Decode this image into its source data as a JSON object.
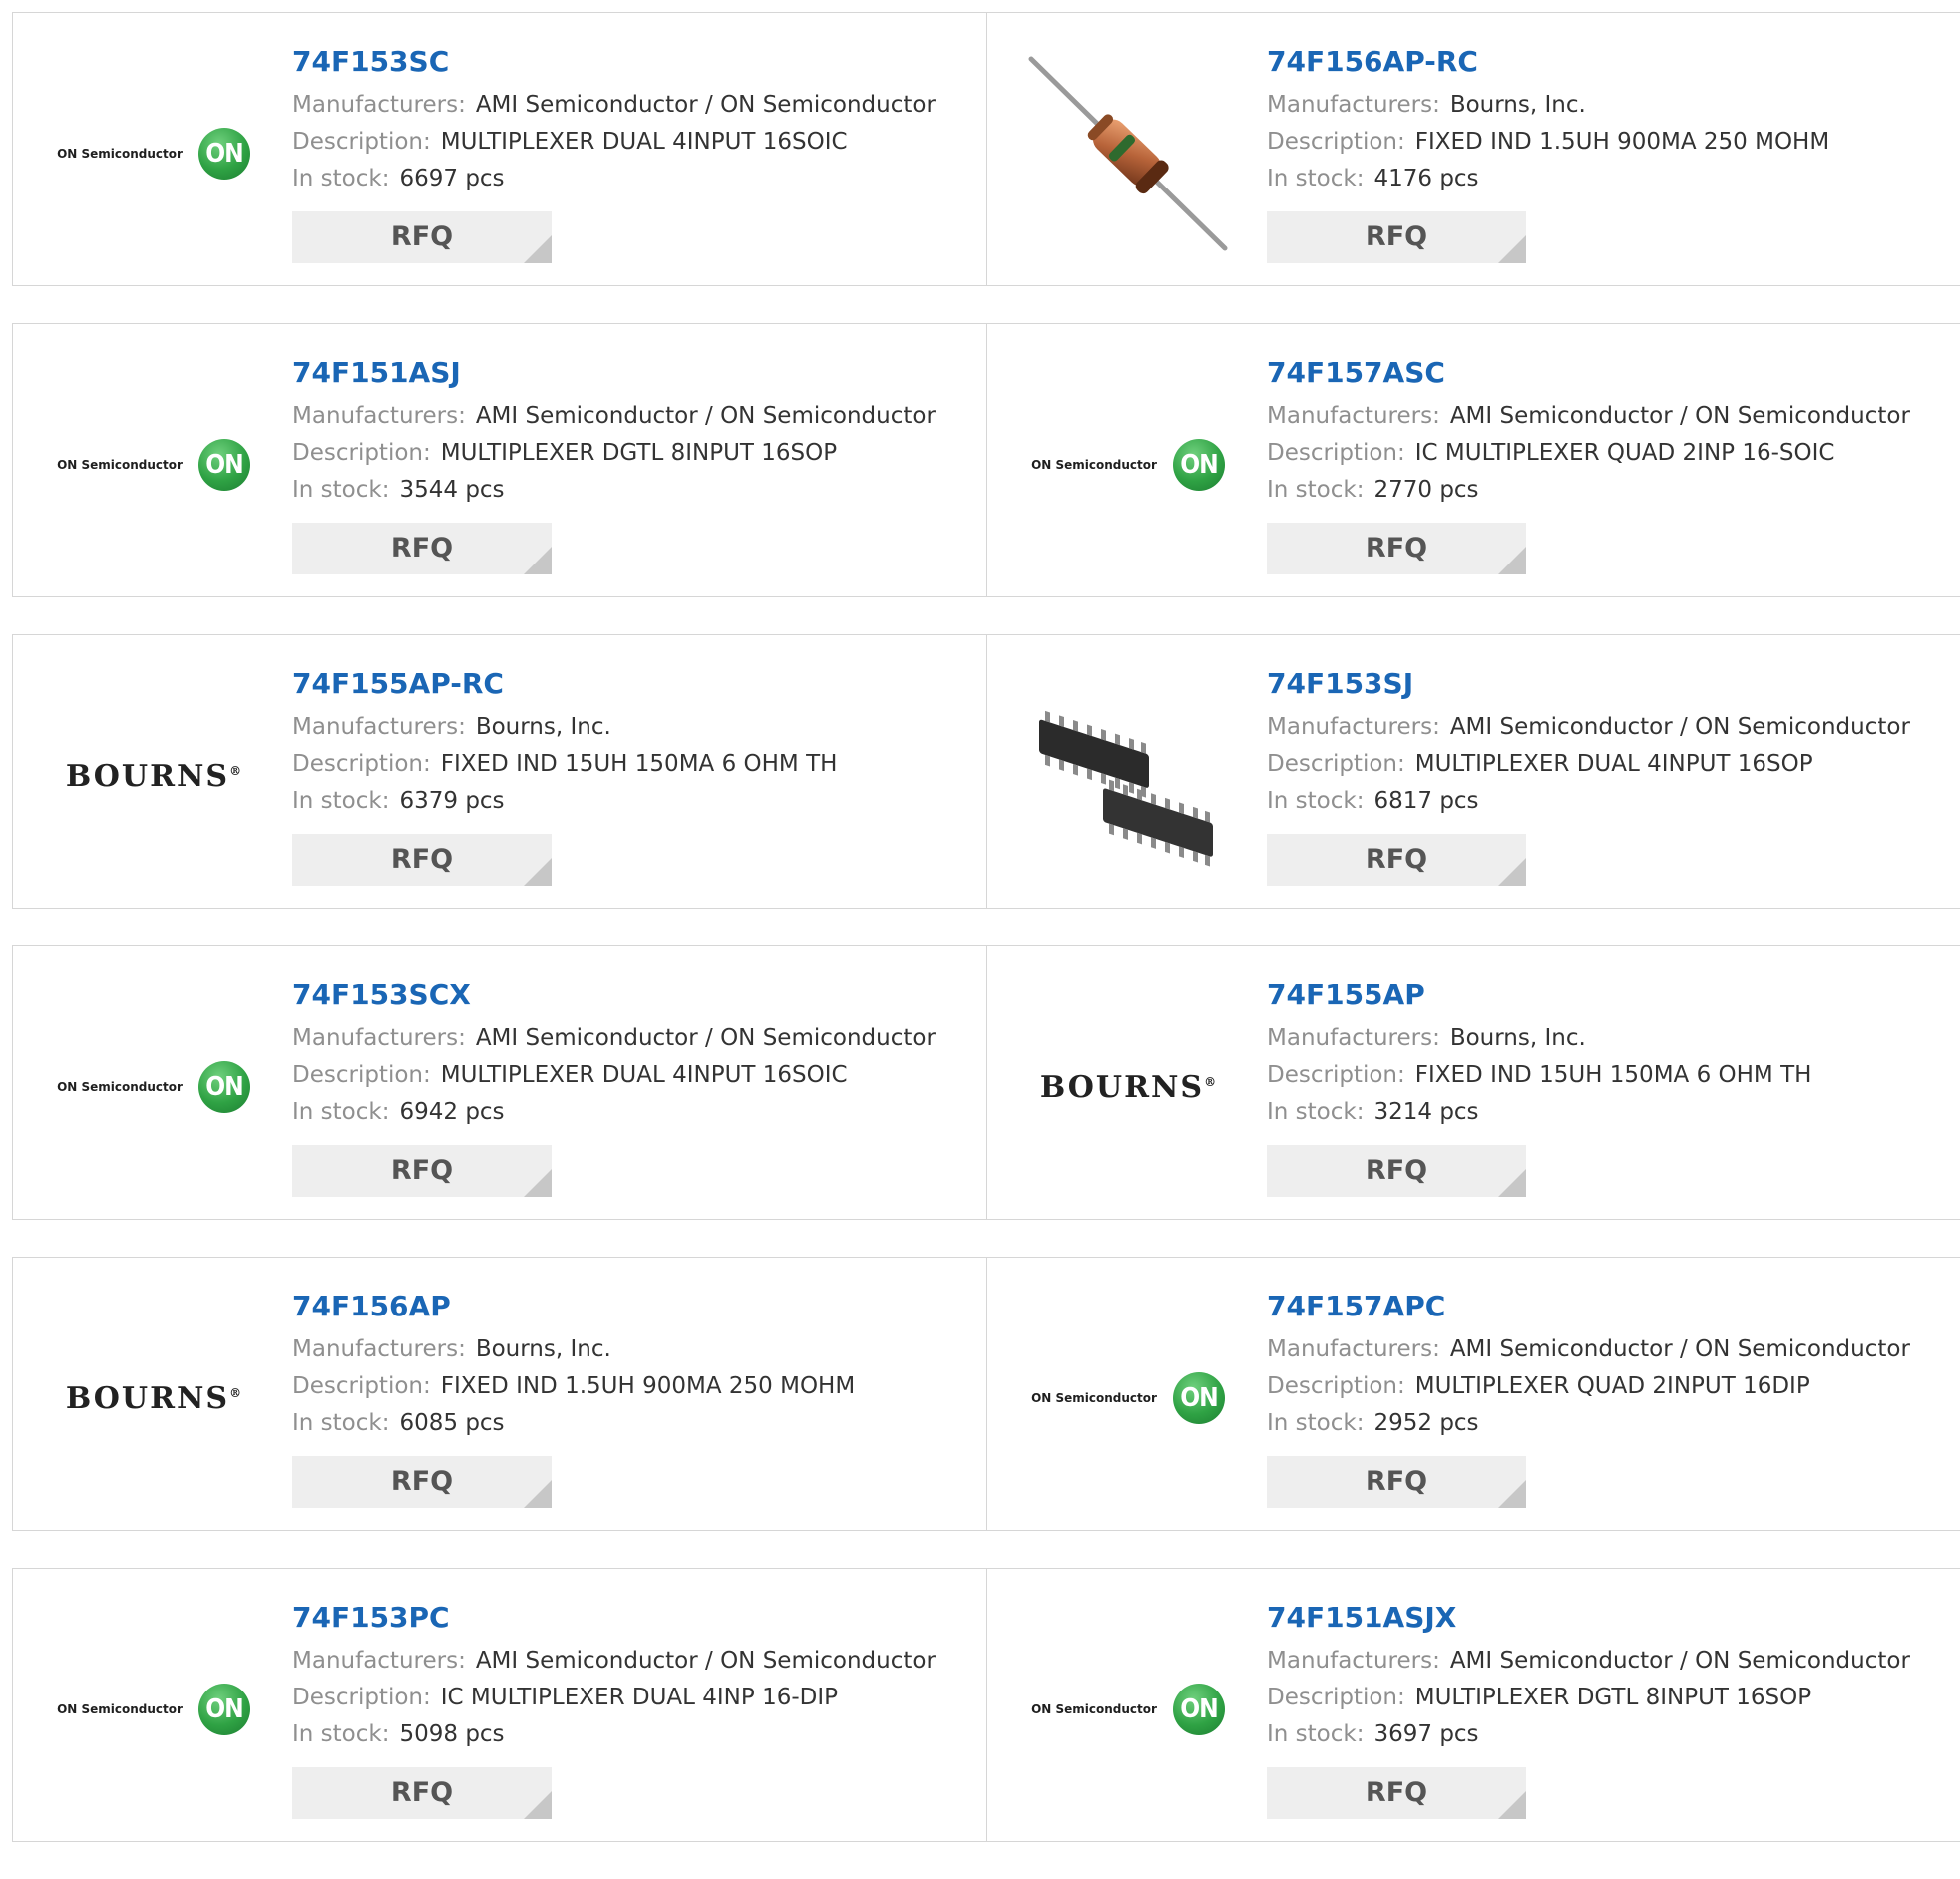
{
  "labels": {
    "manufacturers": "Manufacturers:",
    "description": "Description:",
    "in_stock": "In stock:"
  },
  "rows": [
    [
      {
        "part": "74F153SC",
        "manufacturer": "AMI Semiconductor / ON Semiconductor",
        "description": "MULTIPLEXER DUAL 4INPUT 16SOIC",
        "stock": "6697 pcs",
        "button": "RFQ",
        "image": "on-semiconductor-logo",
        "logo_text": "ON Semiconductor",
        "logo_mark": "ON"
      },
      {
        "part": "74F156AP-RC",
        "manufacturer": "Bourns, Inc.",
        "description": "FIXED IND 1.5UH 900MA 250 MOHM",
        "stock": "4176 pcs",
        "button": "RFQ",
        "image": "axial-inductor-photo"
      }
    ],
    [
      {
        "part": "74F151ASJ",
        "manufacturer": "AMI Semiconductor / ON Semiconductor",
        "description": "MULTIPLEXER DGTL 8INPUT 16SOP",
        "stock": "3544 pcs",
        "button": "RFQ",
        "image": "on-semiconductor-logo",
        "logo_text": "ON Semiconductor",
        "logo_mark": "ON"
      },
      {
        "part": "74F157ASC",
        "manufacturer": "AMI Semiconductor / ON Semiconductor",
        "description": "IC MULTIPLEXER QUAD 2INP 16-SOIC",
        "stock": "2770 pcs",
        "button": "RFQ",
        "image": "on-semiconductor-logo",
        "logo_text": "ON Semiconductor",
        "logo_mark": "ON"
      }
    ],
    [
      {
        "part": "74F155AP-RC",
        "manufacturer": "Bourns, Inc.",
        "description": "FIXED IND 15UH 150MA 6 OHM TH",
        "stock": "6379 pcs",
        "button": "RFQ",
        "image": "bourns-logo",
        "logo_text": "BOURNS"
      },
      {
        "part": "74F153SJ",
        "manufacturer": "AMI Semiconductor / ON Semiconductor",
        "description": "MULTIPLEXER DUAL 4INPUT 16SOP",
        "stock": "6817 pcs",
        "button": "RFQ",
        "image": "soic-chip-photo"
      }
    ],
    [
      {
        "part": "74F153SCX",
        "manufacturer": "AMI Semiconductor / ON Semiconductor",
        "description": "MULTIPLEXER DUAL 4INPUT 16SOIC",
        "stock": "6942 pcs",
        "button": "RFQ",
        "image": "on-semiconductor-logo",
        "logo_text": "ON Semiconductor",
        "logo_mark": "ON"
      },
      {
        "part": "74F155AP",
        "manufacturer": "Bourns, Inc.",
        "description": "FIXED IND 15UH 150MA 6 OHM TH",
        "stock": "3214 pcs",
        "button": "RFQ",
        "image": "bourns-logo",
        "logo_text": "BOURNS"
      }
    ],
    [
      {
        "part": "74F156AP",
        "manufacturer": "Bourns, Inc.",
        "description": "FIXED IND 1.5UH 900MA 250 MOHM",
        "stock": "6085 pcs",
        "button": "RFQ",
        "image": "bourns-logo",
        "logo_text": "BOURNS"
      },
      {
        "part": "74F157APC",
        "manufacturer": "AMI Semiconductor / ON Semiconductor",
        "description": "MULTIPLEXER QUAD 2INPUT 16DIP",
        "stock": "2952 pcs",
        "button": "RFQ",
        "image": "on-semiconductor-logo",
        "logo_text": "ON Semiconductor",
        "logo_mark": "ON"
      }
    ],
    [
      {
        "part": "74F153PC",
        "manufacturer": "AMI Semiconductor / ON Semiconductor",
        "description": "IC MULTIPLEXER DUAL 4INP 16-DIP",
        "stock": "5098 pcs",
        "button": "RFQ",
        "image": "on-semiconductor-logo",
        "logo_text": "ON Semiconductor",
        "logo_mark": "ON"
      },
      {
        "part": "74F151ASJX",
        "manufacturer": "AMI Semiconductor / ON Semiconductor",
        "description": "MULTIPLEXER DGTL 8INPUT 16SOP",
        "stock": "3697 pcs",
        "button": "RFQ",
        "image": "on-semiconductor-logo",
        "logo_text": "ON Semiconductor",
        "logo_mark": "ON"
      }
    ]
  ],
  "colors": {
    "part_link": "#1a66b5",
    "label": "#8f8f8f",
    "value": "#333333",
    "button_bg": "#eeeeee",
    "on_green": "#2fa244"
  }
}
